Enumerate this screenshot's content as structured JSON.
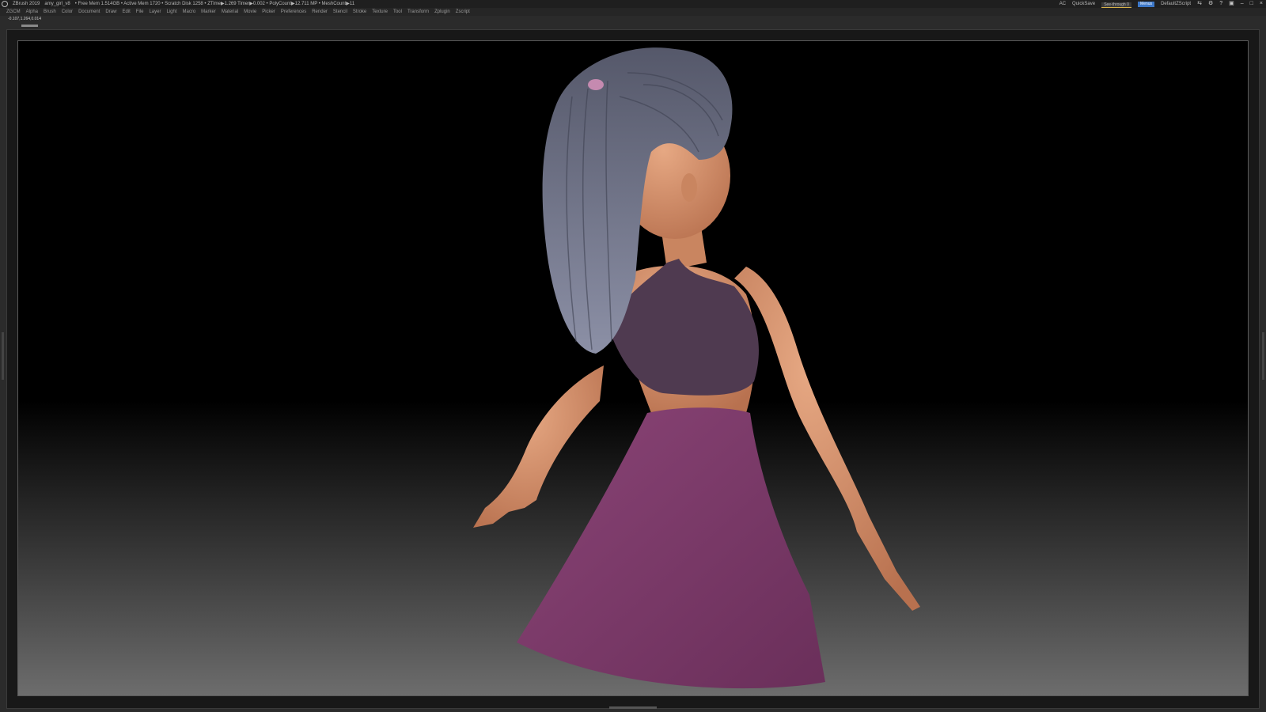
{
  "titlebar": {
    "app": "ZBrush 2019",
    "file": "amy_girl_v8",
    "stats": "• Free Mem 1.514GB • Active Mem 1720 • Scratch Disk 1258 • ZTime▶1.269 Timer▶0.002 • PolyCount▶12.711 MP • MeshCount▶11",
    "ac": "AC",
    "quicksave": "QuickSave",
    "see_through": "See-through 0",
    "menus_btn": "Menus",
    "script": "DefaultZScript"
  },
  "menubar": [
    "ZGCM",
    "Alpha",
    "Brush",
    "Color",
    "Document",
    "Draw",
    "Edit",
    "File",
    "Layer",
    "Light",
    "Macro",
    "Marker",
    "Material",
    "Movie",
    "Picker",
    "Preferences",
    "Render",
    "Stencil",
    "Stroke",
    "Texture",
    "Tool",
    "Transform",
    "Zplugin",
    "Zscript"
  ],
  "status": {
    "coords": "-0.107,1.264,0.014"
  },
  "colors": {
    "hair": "#5f6272",
    "top": "#4f3a50",
    "skirt": "#7c3b6a",
    "skin": "#d9936f",
    "scrunchie": "#c58ab0"
  }
}
